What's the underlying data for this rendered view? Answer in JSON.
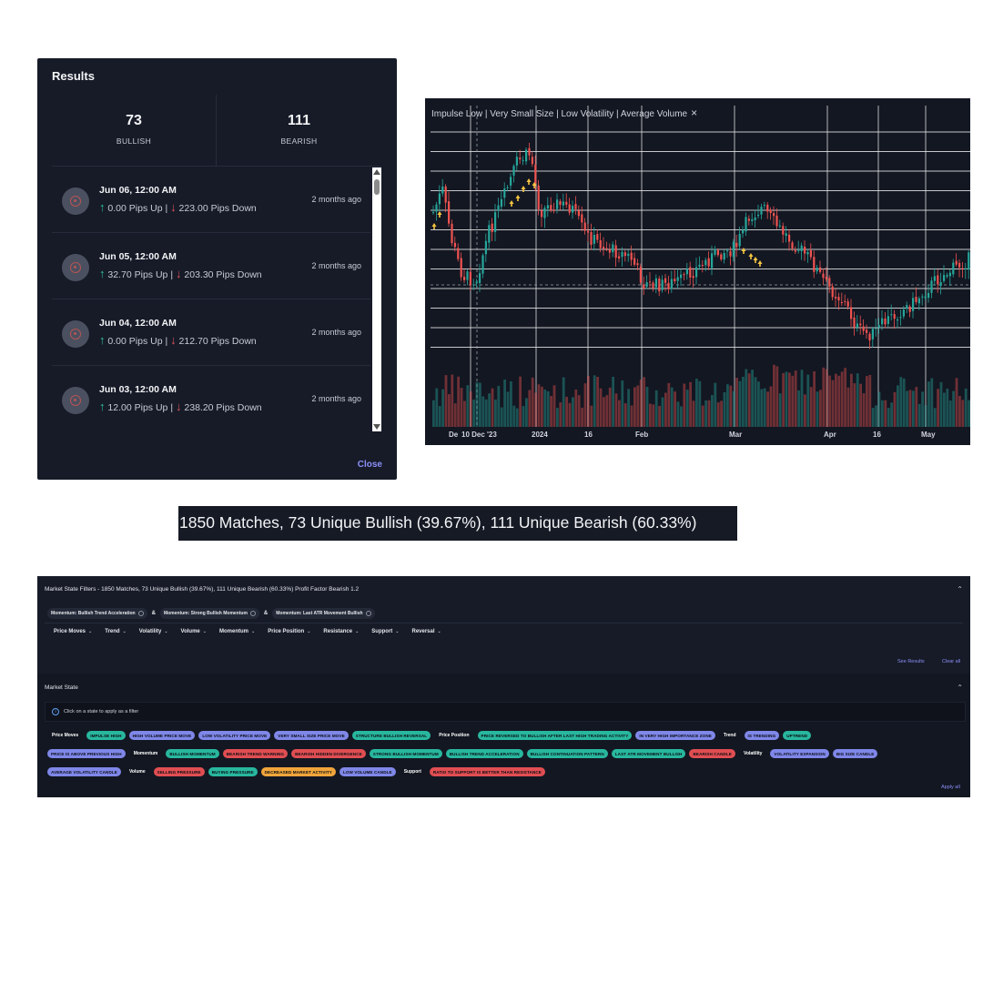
{
  "results": {
    "title": "Results",
    "bullish": {
      "count": "73",
      "label": "BULLISH"
    },
    "bearish": {
      "count": "111",
      "label": "BEARISH"
    },
    "items": [
      {
        "date": "Jun 06, 12:00 AM",
        "up": "0.00 Pips Up",
        "sep": "|",
        "down": "223.00 Pips Down",
        "ago": "2 months ago"
      },
      {
        "date": "Jun 05, 12:00 AM",
        "up": "32.70 Pips Up",
        "sep": "|",
        "down": "203.30 Pips Down",
        "ago": "2 months ago"
      },
      {
        "date": "Jun 04, 12:00 AM",
        "up": "0.00 Pips Up",
        "sep": "|",
        "down": "212.70 Pips Down",
        "ago": "2 months ago"
      },
      {
        "date": "Jun 03, 12:00 AM",
        "up": "12.00 Pips Up",
        "sep": "|",
        "down": "238.20 Pips Down",
        "ago": "2 months ago"
      }
    ],
    "close_label": "Close"
  },
  "chart": {
    "legend": "Impulse Low | Very Small Size | Low Volatility | Average Volume",
    "x_labels": [
      "De",
      "10 Dec '23",
      "2024",
      "16",
      "Feb",
      "Mar",
      "Apr",
      "16",
      "May"
    ],
    "colors": {
      "bull": "#26a69a",
      "bear": "#ef5350",
      "marker": "#f5c542",
      "grid": "#e6e6e6"
    }
  },
  "summary": {
    "text": "1850 Matches, 73 Unique Bullish (39.67%), 111 Unique Bearish (60.33%)"
  },
  "filters": {
    "title": "Market State Filters - 1850 Matches, 73 Unique Bullish (39.67%), 111 Unique Bearish (60.33%) Profit Factor Bearish 1.2",
    "active": [
      "Momentum: Bullish Trend Acceleration",
      "Momentum: Strong Bullish Momentum",
      "Momentum: Last ATR Movement Bullish"
    ],
    "amp": "&",
    "dropdowns": [
      "Price Moves",
      "Trend",
      "Volatility",
      "Volume",
      "Momentum",
      "Price Position",
      "Resistance",
      "Support",
      "Reversal"
    ],
    "see_results": "See Results",
    "clear_all": "Clear all"
  },
  "market_state": {
    "title": "Market State",
    "info": "Click on a state to apply as a filter",
    "apply_all": "Apply all",
    "rows": [
      [
        {
          "type": "group",
          "label": "Price Moves"
        },
        {
          "type": "chip",
          "label": "IMPULSE HIGH",
          "color": "teal"
        },
        {
          "type": "chip",
          "label": "HIGH VOLUME PRICE MOVE",
          "color": "purple"
        },
        {
          "type": "chip",
          "label": "LOW VOLATILITY PRICE MOVE",
          "color": "purple"
        },
        {
          "type": "chip",
          "label": "VERY SMALL SIZE PRICE MOVE",
          "color": "purple"
        },
        {
          "type": "chip",
          "label": "STRUCTURE BULLISH REVERSAL",
          "color": "teal"
        },
        {
          "type": "group",
          "label": "Price Position"
        },
        {
          "type": "chip",
          "label": "PRICE REVERSED TO BULLISH AFTER LAST HIGH TRADING ACTIVITY",
          "color": "teal"
        },
        {
          "type": "chip",
          "label": "IN VERY HIGH IMPORTANCE ZONE",
          "color": "purple"
        },
        {
          "type": "group",
          "label": "Trend"
        },
        {
          "type": "chip",
          "label": "IS TRENDING",
          "color": "purple"
        },
        {
          "type": "chip",
          "label": "UPTREND",
          "color": "teal"
        }
      ],
      [
        {
          "type": "chip",
          "label": "PRICE IS ABOVE PREVIOUS HIGH",
          "color": "purple"
        },
        {
          "type": "group",
          "label": "Momentum"
        },
        {
          "type": "chip",
          "label": "BULLISH MOMENTUM",
          "color": "teal"
        },
        {
          "type": "chip",
          "label": "BEARISH TREND WARNING",
          "color": "red"
        },
        {
          "type": "chip",
          "label": "BEARISH HIDDEN DIVERGENCE",
          "color": "red"
        },
        {
          "type": "chip",
          "label": "STRONG BULLISH MOMENTUM",
          "color": "teal"
        },
        {
          "type": "chip",
          "label": "BULLISH TREND ACCELERATION",
          "color": "teal"
        },
        {
          "type": "chip",
          "label": "BULLISH CONTINUATION PATTERN",
          "color": "teal"
        },
        {
          "type": "chip",
          "label": "LAST ATR MOVEMENT BULLISH",
          "color": "teal"
        },
        {
          "type": "chip",
          "label": "BEARISH CANDLE",
          "color": "red"
        },
        {
          "type": "group",
          "label": "Volatility"
        },
        {
          "type": "chip",
          "label": "VOLATILITY EXPANSION",
          "color": "purple"
        },
        {
          "type": "chip",
          "label": "BIG SIZE CANDLE",
          "color": "purple"
        }
      ],
      [
        {
          "type": "chip",
          "label": "AVERAGE VOLATILITY CANDLE",
          "color": "purple"
        },
        {
          "type": "group",
          "label": "Volume"
        },
        {
          "type": "chip",
          "label": "SELLING PRESSURE",
          "color": "red"
        },
        {
          "type": "chip",
          "label": "BUYING PRESSURE",
          "color": "teal"
        },
        {
          "type": "chip",
          "label": "DECREASED MARKET ACTIVITY",
          "color": "yellow"
        },
        {
          "type": "chip",
          "label": "LOW VOLUME CANDLE",
          "color": "purple"
        },
        {
          "type": "group",
          "label": "Support"
        },
        {
          "type": "chip",
          "label": "RATIO TO SUPPORT IS BETTER THAN RESISTANCE",
          "color": "red"
        }
      ]
    ]
  }
}
